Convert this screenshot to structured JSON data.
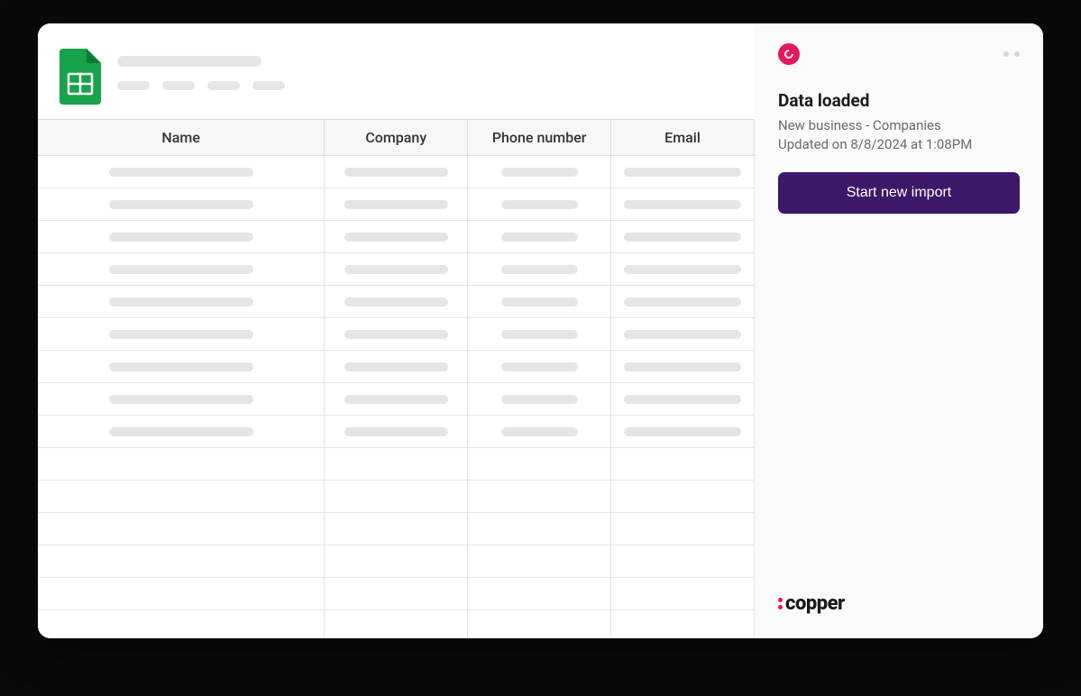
{
  "table": {
    "headers": [
      "Name",
      "Company",
      "Phone number",
      "Email"
    ],
    "filled_rows": 9,
    "empty_rows": 6
  },
  "sidebar": {
    "status_title": "Data loaded",
    "status_subtitle": "New business - Companies",
    "status_updated": "Updated on 8/8/2024 at 1:08PM",
    "import_button": "Start new import",
    "brand": "copper"
  }
}
